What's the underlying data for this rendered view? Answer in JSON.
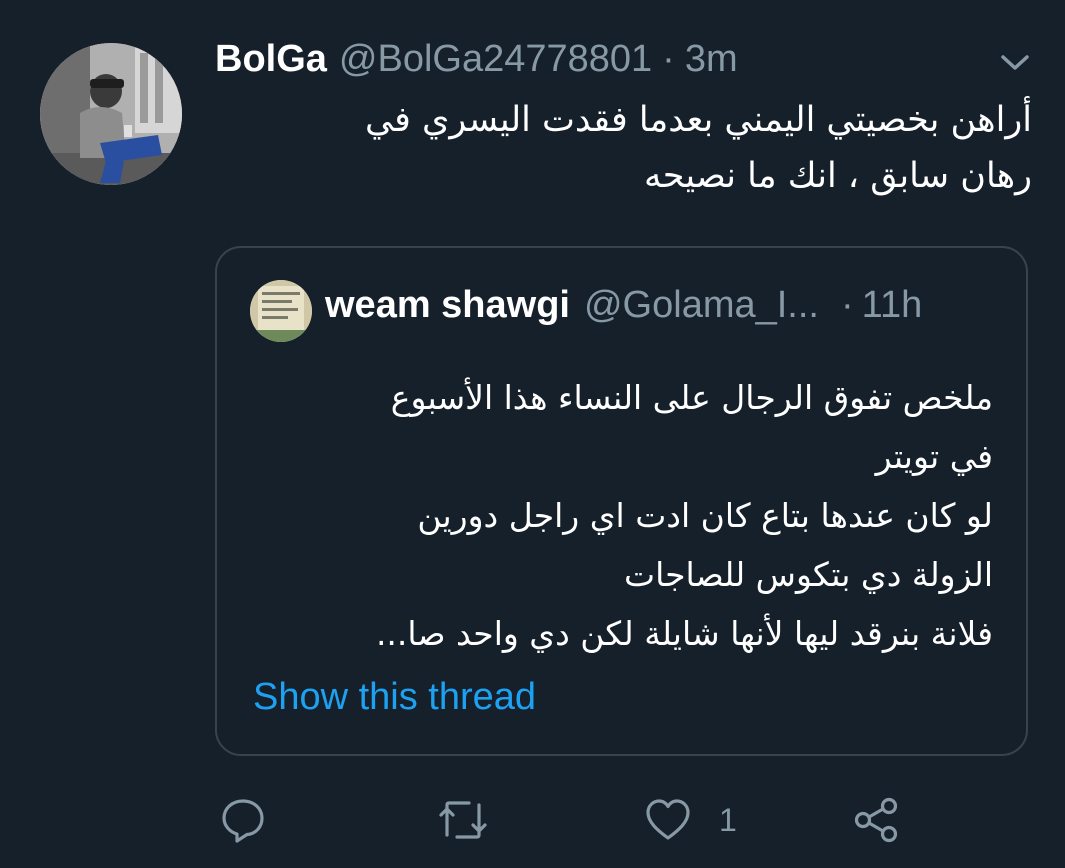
{
  "tweet": {
    "author_name": "BolGa",
    "author_handle": "@BolGa24778801",
    "separator": "·",
    "time": "3m",
    "text": "أراهن بخصيتي اليمني بعدما فقدت اليسري في\nرهان سابق ، انك ما نصيحه"
  },
  "quoted_tweet": {
    "author_name": "weam shawgi",
    "author_handle": "@Golama_I...",
    "separator": "·",
    "time": "11h",
    "text": "ملخص تفوق الرجال على النساء هذا الأسبوع\nفي تويتر\nلو كان عندها بتاع كان ادت اي راجل دورين\nالزولة دي بتكوس للصاجات\nفلانة بنرقد ليها لأنها شايلة لكن دي واحد صا...",
    "show_thread_label": "Show this thread"
  },
  "actions": {
    "reply_icon": "reply-icon",
    "retweet_icon": "retweet-icon",
    "like_icon": "heart-icon",
    "like_count": "1",
    "share_icon": "share-icon"
  },
  "colors": {
    "background": "#15202b",
    "border": "#38444d",
    "secondary_text": "#8899a6",
    "link": "#1da1f2"
  }
}
